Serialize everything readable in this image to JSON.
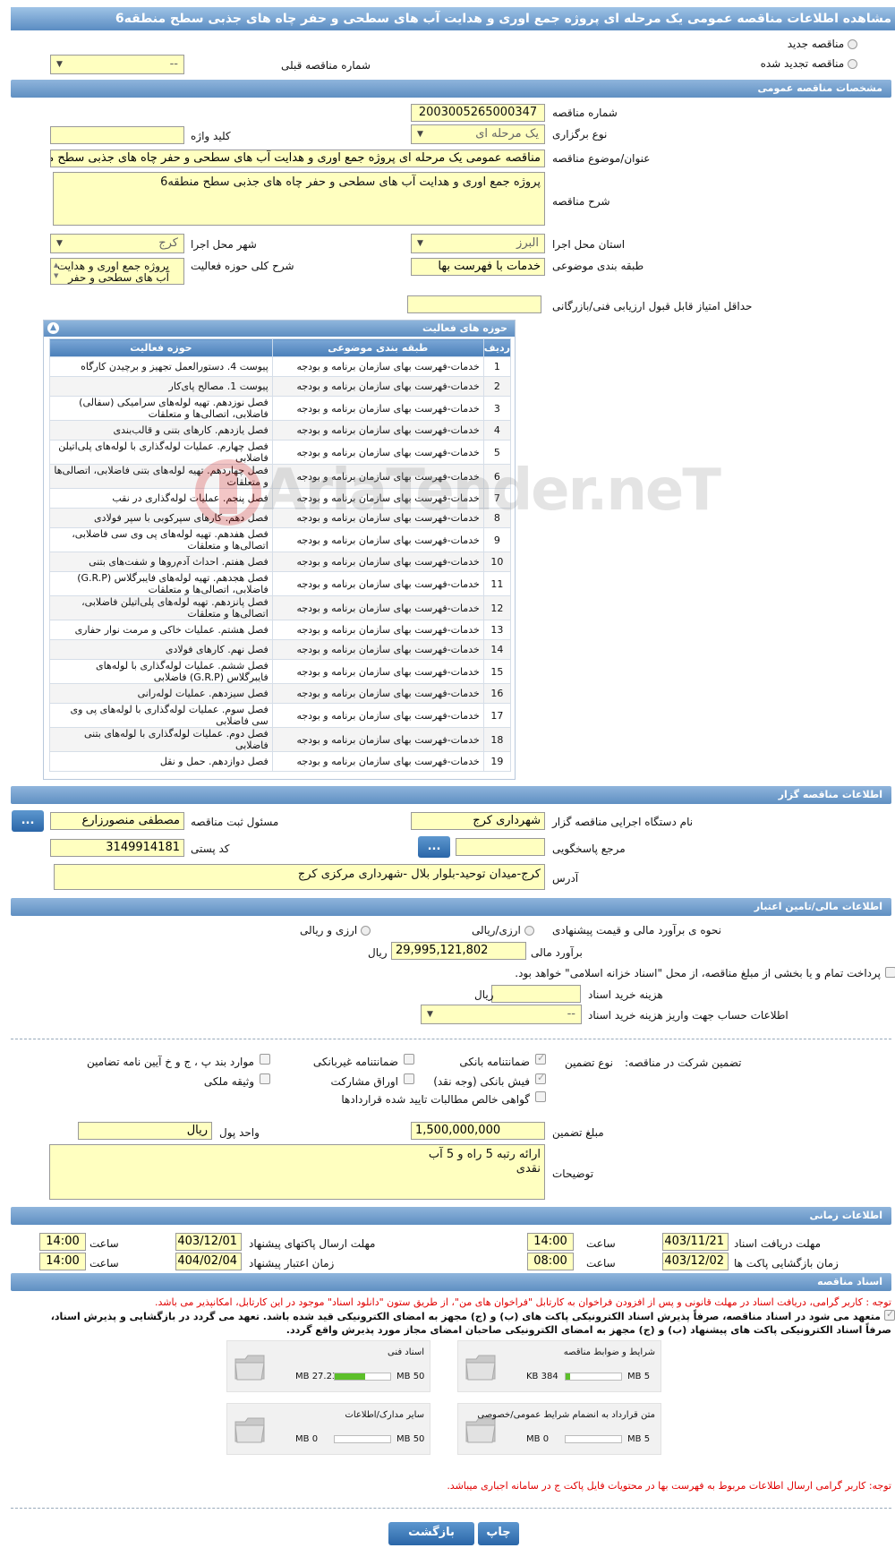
{
  "page_title": "مشاهده اطلاعات مناقصه عمومی یک مرحله ای پروژه جمع اوری و هدایت آب های سطحی و حفر چاه های جذبی سطح منطقه6",
  "tender_type": {
    "new": "مناقصه جدید",
    "renewed": "مناقصه تجدید شده",
    "prev_number_label": "شماره مناقصه قبلی",
    "prev_number_value": "--"
  },
  "general": {
    "section_title": "مشخصات مناقصه عمومی",
    "number_label": "شماره مناقصه",
    "number_value": "2003005265000347",
    "holding_label": "نوع برگزاری",
    "holding_value": "یک مرحله ای",
    "keyword_label": "کلید واژه",
    "keyword_value": "",
    "subject_label": "عنوان/موضوع مناقصه",
    "subject_value": "مناقصه عمومی یک مرحله ای پروژه جمع اوری و هدایت آب های سطحی و حفر چاه های جذبی سطح منطقه6",
    "desc_label": "شرح مناقصه",
    "desc_value": "پروژه جمع اوری و هدایت آب های سطحی و حفر چاه های جذبی سطح منطقه6",
    "province_label": "استان محل اجرا",
    "province_value": "البرز",
    "city_label": "شهر محل اجرا",
    "city_value": "کرج",
    "category_label": "طبقه بندی موضوعی",
    "category_value": "خدمات با فهرست بها",
    "scope_label": "شرح کلی حوزه فعالیت",
    "scope_value": "پروژه جمع اوری و هدایت آب های سطحی و حفر",
    "min_score_label": "حداقل امتیاز قابل قبول ارزیابی فنی/بازرگانی",
    "min_score_value": ""
  },
  "activities": {
    "panel_title": "حوزه های فعالیت",
    "headers": {
      "row": "ردیف",
      "category": "طبقه بندی موضوعی",
      "field": "حوزه فعالیت"
    },
    "rows": [
      {
        "n": "1",
        "cat": "خدمات-فهرست بهای سازمان برنامه و بودجه",
        "field": "پیوست 4. دستورالعمل تجهیز و برچیدن کارگاه"
      },
      {
        "n": "2",
        "cat": "خدمات-فهرست بهای سازمان برنامه و بودجه",
        "field": "پیوست 1. مصالح پای‌کار"
      },
      {
        "n": "3",
        "cat": "خدمات-فهرست بهای سازمان برنامه و بودجه",
        "field": "فصل نوزدهم. تهیه لوله‌های سرامیکی (سفالی) فاضلابی، اتصالی‌ها و متعلقات"
      },
      {
        "n": "4",
        "cat": "خدمات-فهرست بهای سازمان برنامه و بودجه",
        "field": "فصل یازدهم. کارهای بتنی و قالب‌بندی"
      },
      {
        "n": "5",
        "cat": "خدمات-فهرست بهای سازمان برنامه و بودجه",
        "field": "فصل چهارم. عملیات لوله‌گذاری با لوله‌های پلی‌اتیلن فاضلابی"
      },
      {
        "n": "6",
        "cat": "خدمات-فهرست بهای سازمان برنامه و بودجه",
        "field": "فصل چهاردهم. تهیه لوله‌های بتنی فاضلابی، اتصالی‌ها و متعلقات"
      },
      {
        "n": "7",
        "cat": "خدمات-فهرست بهای سازمان برنامه و بودجه",
        "field": "فصل پنجم. عملیات لوله‌گذاری در نقب"
      },
      {
        "n": "8",
        "cat": "خدمات-فهرست بهای سازمان برنامه و بودجه",
        "field": "فصل دهم. کارهای سپرکوبی با سپر فولادی"
      },
      {
        "n": "9",
        "cat": "خدمات-فهرست بهای سازمان برنامه و بودجه",
        "field": "فصل هفدهم. تهیه لوله‌های پی وی سی فاضلابی، اتصالی‌ها و متعلقات"
      },
      {
        "n": "10",
        "cat": "خدمات-فهرست بهای سازمان برنامه و بودجه",
        "field": "فصل هفتم. احداث آدم‌روها و شفت‌های بتنی"
      },
      {
        "n": "11",
        "cat": "خدمات-فهرست بهای سازمان برنامه و بودجه",
        "field": "فصل هجدهم. تهیه لوله‌های فایبرگلاس (G.R.P) فاضلابی، اتصالی‌ها و متعلقات"
      },
      {
        "n": "12",
        "cat": "خدمات-فهرست بهای سازمان برنامه و بودجه",
        "field": "فصل پانزدهم. تهیه لوله‌های پلی‌اتیلن فاضلابی، اتصالی‌ها و متعلقات"
      },
      {
        "n": "13",
        "cat": "خدمات-فهرست بهای سازمان برنامه و بودجه",
        "field": "فصل هشتم. عملیات خاکی و مرمت نوار حفاری"
      },
      {
        "n": "14",
        "cat": "خدمات-فهرست بهای سازمان برنامه و بودجه",
        "field": "فصل نهم. کارهای فولادی"
      },
      {
        "n": "15",
        "cat": "خدمات-فهرست بهای سازمان برنامه و بودجه",
        "field": "فصل ششم. عملیات لوله‌گذاری با لوله‌های فایبرگلاس (G.R.P) فاضلابی"
      },
      {
        "n": "16",
        "cat": "خدمات-فهرست بهای سازمان برنامه و بودجه",
        "field": "فصل سیزدهم. عملیات لوله‌رانی"
      },
      {
        "n": "17",
        "cat": "خدمات-فهرست بهای سازمان برنامه و بودجه",
        "field": "فصل سوم. عملیات لوله‌گذاری با لوله‌های پی وی سی فاضلابی"
      },
      {
        "n": "18",
        "cat": "خدمات-فهرست بهای سازمان برنامه و بودجه",
        "field": "فصل دوم. عملیات لوله‌گذاری با لوله‌های بتنی فاضلابی"
      },
      {
        "n": "19",
        "cat": "خدمات-فهرست بهای سازمان برنامه و بودجه",
        "field": "فصل دوازدهم. حمل و نقل"
      }
    ]
  },
  "organizer": {
    "section_title": "اطلاعات مناقصه گزار",
    "org_label": "نام دستگاه اجرایی مناقصه گزار",
    "org_value": "شهرداری کرج",
    "resp_label": "مسئول ثبت مناقصه",
    "resp_value": "مصطفی منصورزارع",
    "ref_label": "مرجع پاسخگویی",
    "ref_value": "",
    "postal_label": "کد پستی",
    "postal_value": "3149914181",
    "address_label": "آدرس",
    "address_value": "کرج-میدان توحید-بلوار بلال -شهرداری مرکزی کرج",
    "dots": "..."
  },
  "finance": {
    "section_title": "اطلاعات مالی/تامین اعتبار",
    "method_label": "نحوه ی برآورد مالی و قیمت پیشنهادی",
    "opt_rial_fx": "ارزی/ریالی",
    "opt_fx_rial": "ارزی و ریالی",
    "estimate_label": "برآورد مالی",
    "estimate_value": "29,995,121,802",
    "currency": "ریال",
    "treasury_text": "پرداخت تمام و یا بخشی از مبلغ مناقصه، از محل \"اسناد خزانه اسلامی\" خواهد بود.",
    "doc_fee_label": "هزینه خرید اسناد",
    "doc_fee_unit": "ریال",
    "account_label": "اطلاعات حساب جهت واریز هزینه خرید اسناد",
    "account_value": "--"
  },
  "guarantee": {
    "title": "تضمین شرکت در مناقصه:",
    "type_label": "نوع تضمین",
    "opt_bank": "ضمانتنامه بانکی",
    "opt_nonbank": "ضمانتنامه غیربانکی",
    "opt_clauses": "موارد بند پ ، ج و خ آیین نامه تضامین",
    "opt_cash": "فیش بانکی (وجه نقد)",
    "opt_bonds": "اوراق مشارکت",
    "opt_property": "وثیقه ملکی",
    "opt_claims": "گواهی خالص مطالبات تایید شده قراردادها",
    "amount_label": "مبلغ تضمین",
    "amount_value": "1,500,000,000",
    "unit_label": "واحد پول",
    "unit_value": "ریال",
    "notes_label": "توضیحات",
    "notes_line1": "ارائه رتبه 5 راه و 5 آب",
    "notes_line2": "نقدی"
  },
  "timing": {
    "section_title": "اطلاعات زمانی",
    "receive_label": "مهلت دریافت اسناد",
    "receive_date": "1403/11/21",
    "receive_time": "14:00",
    "send_label": "مهلت ارسال پاکتهای پیشنهاد",
    "send_date": "1403/12/01",
    "send_time": "14:00",
    "open_label": "زمان بازگشایی پاکت ها",
    "open_date": "1403/12/02",
    "open_time": "08:00",
    "valid_label": "زمان اعتبار پیشنهاد",
    "valid_date": "1404/02/04",
    "valid_time": "14:00",
    "time_label": "ساعت"
  },
  "documents": {
    "section_title": "اسناد مناقصه",
    "note1": "توجه : کاربر گرامی، دریافت اسناد در مهلت قانونی و پس از افزودن فراخوان به کارتابل \"فراخوان های من\"، از طریق ستون \"دانلود اسناد\" موجود در این کارتابل، امکانپذیر می باشد.",
    "commit_line1": "متعهد می شود در اسناد مناقصه، صرفاً پذیرش اسناد الکترونیکی پاکت های (ب) و (ج) مجهز به امضای الکترونیکی قید شده باشد. تعهد می گردد در بازگشایی و پذیرش اسناد،",
    "commit_line2": "صرفاً اسناد الکترونیکی پاکت های پیشنهاد (ب) و (ج) مجهز به امضای الکترونیکی صاحبان امضای مجاز مورد پذیرش واقع گردد.",
    "files": [
      {
        "title": "شرایط و ضوابط مناقصه",
        "used": "384 KB",
        "max": "5 MB",
        "fraction": 0.075
      },
      {
        "title": "اسناد فنی",
        "used": "27.23 MB",
        "max": "50 MB",
        "fraction": 0.545
      },
      {
        "title": "متن قرارداد به انضمام شرایط عمومی/خصوصی",
        "used": "0 MB",
        "max": "5 MB",
        "fraction": 0
      },
      {
        "title": "سایر مدارک/اطلاعات",
        "used": "0 MB",
        "max": "50 MB",
        "fraction": 0
      }
    ],
    "note2": "توجه: کاربر گرامی ارسال اطلاعات مربوط به فهرست بها در محتویات فایل پاکت ج در سامانه اجباری میباشد."
  },
  "actions": {
    "back": "بازگشت",
    "print": "چاپ"
  },
  "watermark": "AriaTender.neT",
  "colors": {
    "header_blue": "#5f8fc2",
    "field_yellow": "#ffffc0",
    "note_red": "#e00000",
    "progress_green": "#5cbf2a"
  }
}
